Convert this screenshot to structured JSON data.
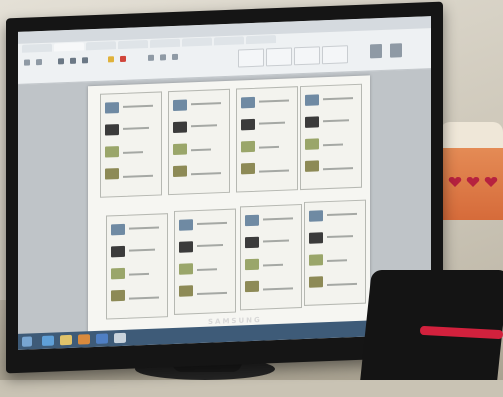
{
  "monitor": {
    "brand_label": "SAMSUNG"
  },
  "colors": {
    "taskbar": "#3e5b78",
    "ribbon": "#eef1f3",
    "page": "#f6f6f2",
    "pen": "#d2213d",
    "box": "#e48b55"
  },
  "icons": [
    "windows-start-icon",
    "ie-icon",
    "folder-icon",
    "media-icon",
    "word-icon",
    "paint-icon"
  ]
}
